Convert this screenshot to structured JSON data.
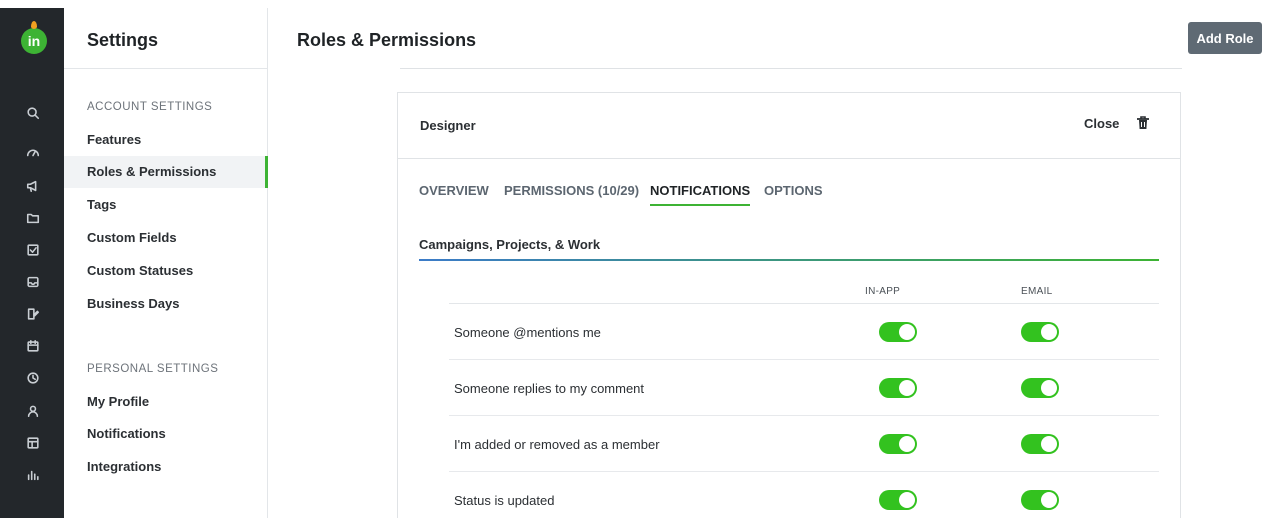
{
  "app": {
    "logo_text": "in"
  },
  "rail": {
    "icons": [
      "search-icon",
      "dashboard-icon",
      "campaign-icon",
      "folder-icon",
      "task-icon",
      "inbox-icon",
      "asset-icon",
      "calendar-icon",
      "clock-icon",
      "people-icon",
      "board-icon",
      "report-icon"
    ]
  },
  "settings": {
    "title": "Settings",
    "account_label": "ACCOUNT SETTINGS",
    "account_items": [
      "Features",
      "Roles & Permissions",
      "Tags",
      "Custom Fields",
      "Custom Statuses",
      "Business Days"
    ],
    "personal_label": "PERSONAL SETTINGS",
    "personal_items": [
      "My Profile",
      "Notifications",
      "Integrations"
    ]
  },
  "header": {
    "title": "Roles & Permissions",
    "add_role_label": "Add Role"
  },
  "role": {
    "name": "Designer",
    "close_label": "Close",
    "tabs": [
      "OVERVIEW",
      "PERMISSIONS (10/29)",
      "NOTIFICATIONS",
      "OPTIONS"
    ],
    "active_tab": "NOTIFICATIONS",
    "section_title": "Campaigns, Projects, & Work",
    "columns": {
      "in_app": "IN-APP",
      "email": "EMAIL"
    },
    "rows": [
      {
        "label": "Someone @mentions me",
        "in_app": true,
        "email": true
      },
      {
        "label": "Someone replies to my comment",
        "in_app": true,
        "email": true
      },
      {
        "label": "I'm added or removed as a member",
        "in_app": true,
        "email": true
      },
      {
        "label": "Status is updated",
        "in_app": true,
        "email": true
      }
    ]
  },
  "colors": {
    "accent": "#3db334",
    "toggle_on": "#33c21f",
    "rail_bg": "#23272b",
    "button_bg": "#5f6a74"
  }
}
